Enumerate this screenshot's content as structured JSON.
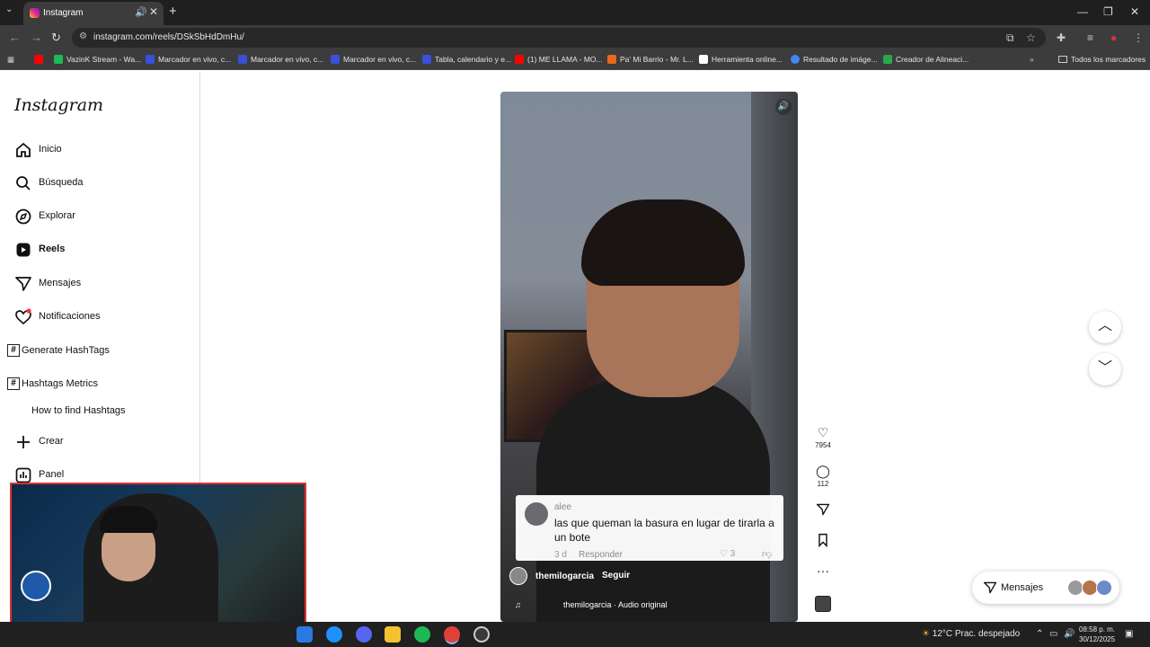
{
  "browser": {
    "tab_title": "Instagram",
    "url": "instagram.com/reels/DSkSbHdDmHu/",
    "bookmarks": [
      {
        "label": "VazinK Stream - Wa...",
        "color": "#1db954"
      },
      {
        "label": "Marcador en vivo, c...",
        "color": "#3b4fd8"
      },
      {
        "label": "Marcador en vivo, c...",
        "color": "#3b4fd8"
      },
      {
        "label": "Marcador en vivo, c...",
        "color": "#3b4fd8"
      },
      {
        "label": "Tabla, calendario y e...",
        "color": "#3b4fd8"
      },
      {
        "label": "(1) ME LLAMA - MO...",
        "color": "#ff0000"
      },
      {
        "label": "Pa' Mi Barrio - Mr. L...",
        "color": "#e86a1a"
      },
      {
        "label": "Herramienta online...",
        "color": "#ffffff"
      },
      {
        "label": "Resultado de imáge...",
        "color": "#4285f4"
      },
      {
        "label": "Creador de Alineaci...",
        "color": "#2aa84a"
      }
    ],
    "all_bookmarks_label": "Todos los marcadores"
  },
  "sidebar": {
    "logo": "Instagram",
    "items": [
      {
        "label": "Inicio",
        "icon": "home-icon"
      },
      {
        "label": "Búsqueda",
        "icon": "search-icon"
      },
      {
        "label": "Explorar",
        "icon": "compass-icon"
      },
      {
        "label": "Reels",
        "icon": "reels-icon"
      },
      {
        "label": "Mensajes",
        "icon": "send-icon"
      },
      {
        "label": "Notificaciones",
        "icon": "heart-icon"
      }
    ],
    "extensions": [
      {
        "label": "Generate HashTags"
      },
      {
        "label": "Hashtags Metrics"
      }
    ],
    "how_to": "How to find Hashtags",
    "create": "Crear",
    "panel": "Panel"
  },
  "reel": {
    "comment": {
      "user": "alee",
      "text": "las que queman la basura en lugar de tirarla a un bote",
      "age": "3 d",
      "reply": "Responder",
      "likes": "3"
    },
    "author": "themilogarcia",
    "follow": "Seguir",
    "audio": "themilogarcia · Audio original",
    "like_count": "7954",
    "comment_count": "112"
  },
  "messages_pill": {
    "label": "Mensajes"
  },
  "taskbar": {
    "weather": "12°C  Prac. despejado",
    "time": "08:58 p. m.",
    "date": "30/12/2025"
  },
  "colors": {
    "accent": "#0095f6",
    "notification_dot": "#ff3040",
    "webcam_border": "#e03030"
  }
}
